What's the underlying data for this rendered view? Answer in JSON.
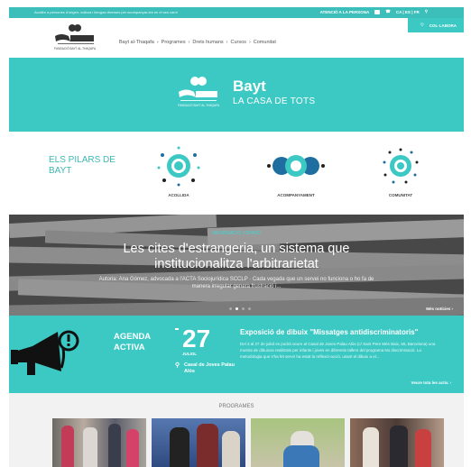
{
  "topbar": {
    "message": "Acollim a persones d'origen, cultura i llengua diverses per acompanyar-les en el seu camí",
    "attention": "ATENCIÓ A LA PERSONA",
    "languages": "CA | ES | FR"
  },
  "header": {
    "logo_text": "FUNDACIÓ BAYT AL-THAQAFA",
    "nav": [
      "Bayt al-Thaqafa",
      "Programes",
      "Drets humans",
      "Cursos",
      "Comunitat"
    ],
    "nav_separator": "›",
    "collabora": "COL·LABORA"
  },
  "hero": {
    "title": "Bayt",
    "subtitle": "LA CASA DE TOTS",
    "logo_text": "FUNDACIÓ BAYT AL-THAQAFA"
  },
  "pillars": {
    "title": "ELS PILARS DE BAYT",
    "items": [
      {
        "label": "ACOLLIDA",
        "icon": "welcome-icon"
      },
      {
        "label": "ACOMPANYAMENT",
        "icon": "accompaniment-icon"
      },
      {
        "label": "COMUNITAT",
        "icon": "community-icon"
      }
    ]
  },
  "news": {
    "tag": "INFORMACIÓ | OPINIÓ",
    "title_line1": "Les cites d'estrangeria, un sistema que",
    "title_line2": "institucionalitza l'arbitrarietat",
    "body": "Autoria: Ana Gómez, advocada a l'ACTA Sociojurídica SCCLP · Cada vegada que un servei no funciona o ho fa de manera irregular genera frustració i...",
    "more": "Més notícies ›",
    "slides": 4,
    "active_slide": 2
  },
  "agenda": {
    "label_line1": "AGENDA",
    "label_line2": "ACTIVA",
    "day": "27",
    "month": "JULIOL",
    "venue": "Casal de Joves Palau Alòs",
    "event_title": "Exposició de dibuix \"Missatges antidiscriminatoris\"",
    "event_desc": "Del 3 al 27 de juliol es podrà veure al Casal de Joves Palau Alòs (c/ Sant Pere Més Baix, 55, Barcelona) una mostra de dibuixos realitzats per infants i joves en diferents tallers del programa No discriminació. La metodologia que s'ha fet servir ha estat la reflexió-acció, usant el dibuix a el...",
    "more": "Veure tota les activ. ›"
  },
  "programes": {
    "title": "PROGRAMES"
  },
  "colors": {
    "accent": "#3cc8c3",
    "topbar": "#3cbfba",
    "dark": "#2a2a2a",
    "pillar_blue": "#1e6f9f"
  }
}
